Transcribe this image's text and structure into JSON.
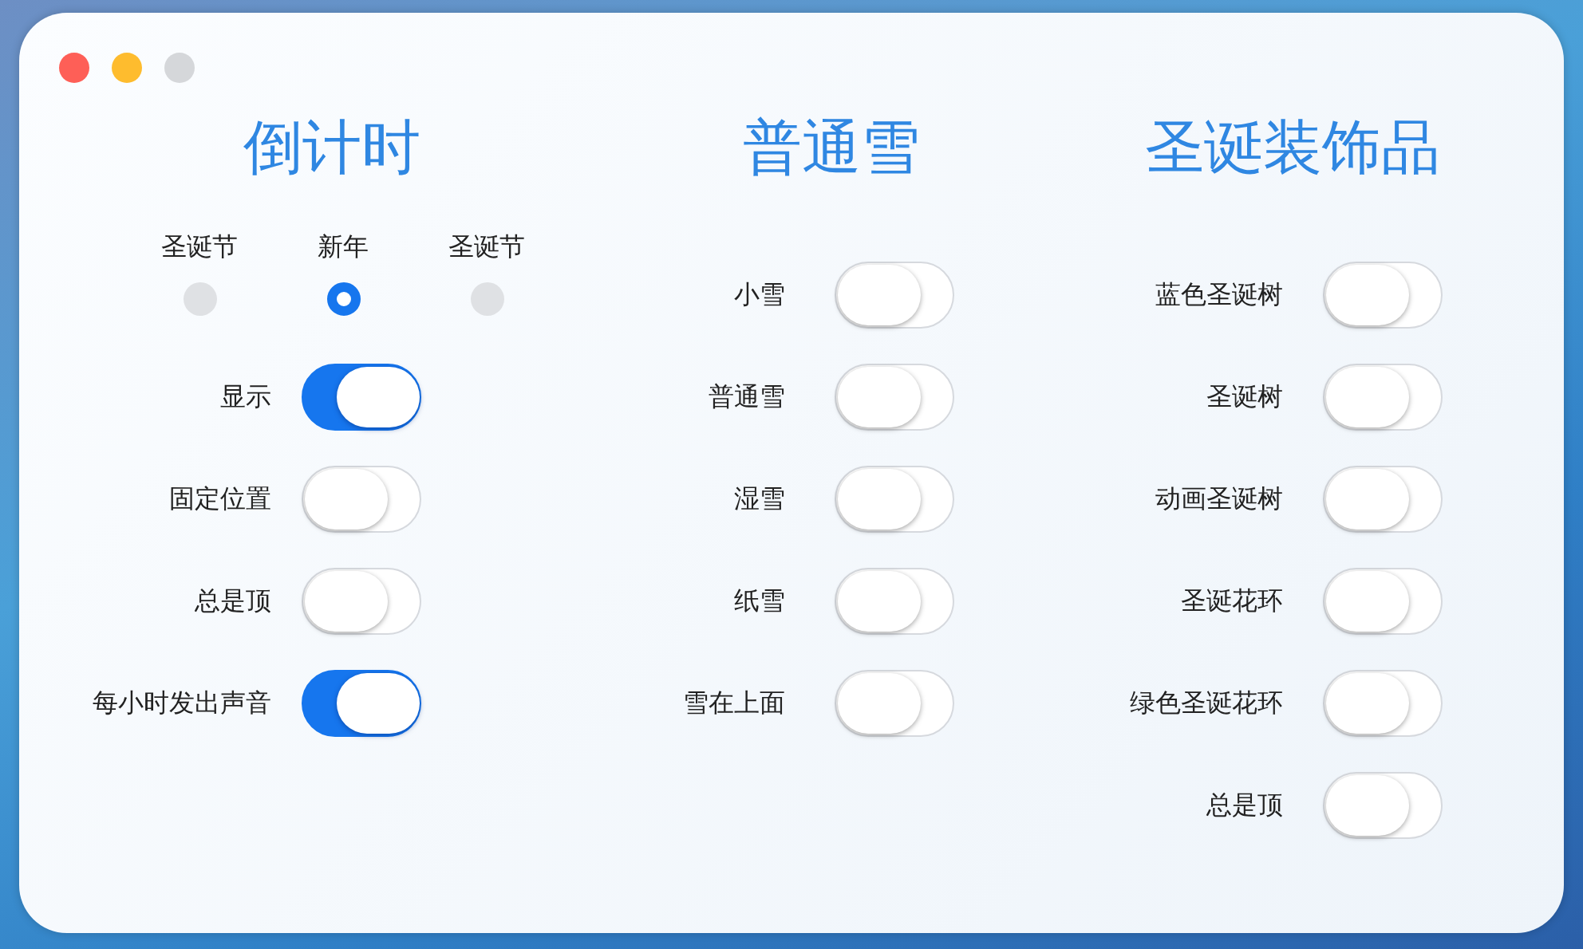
{
  "columns": [
    {
      "title": "倒计时",
      "radios": [
        {
          "label": "圣诞节",
          "selected": false
        },
        {
          "label": "新年",
          "selected": true
        },
        {
          "label": "圣诞节",
          "selected": false
        }
      ],
      "toggles": [
        {
          "label": "显示",
          "on": true
        },
        {
          "label": "固定位置",
          "on": false
        },
        {
          "label": "总是顶",
          "on": false
        },
        {
          "label": "每小时发出声音",
          "on": true
        }
      ]
    },
    {
      "title": "普通雪",
      "toggles": [
        {
          "label": "小雪",
          "on": false
        },
        {
          "label": "普通雪",
          "on": false
        },
        {
          "label": "湿雪",
          "on": false
        },
        {
          "label": "纸雪",
          "on": false
        },
        {
          "label": "雪在上面",
          "on": false
        }
      ]
    },
    {
      "title": "圣诞装饰品",
      "toggles": [
        {
          "label": "蓝色圣诞树",
          "on": false
        },
        {
          "label": "圣诞树",
          "on": false
        },
        {
          "label": "动画圣诞树",
          "on": false
        },
        {
          "label": "圣诞花环",
          "on": false
        },
        {
          "label": "绿色圣诞花环",
          "on": false
        },
        {
          "label": "总是顶",
          "on": false
        }
      ]
    }
  ]
}
